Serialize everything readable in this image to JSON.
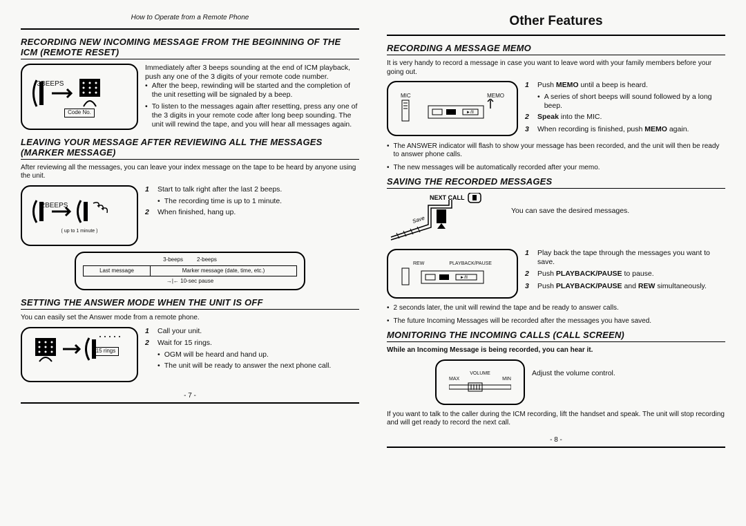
{
  "header": "How to Operate from a Remote Phone",
  "other_features": "Other Features",
  "page_left": "- 7 -",
  "page_right": "- 8 -",
  "left": {
    "sec1": {
      "title": "RECORDING NEW INCOMING MESSAGE FROM THE BEGINNING OF THE ICM (REMOTE RESET)",
      "fig_label": "3BEEPS",
      "fig_code": "Code No.",
      "body1": "Immediately after 3 beeps sounding at the end of ICM playback, push any one of the 3 digits of your remote code number.",
      "b1": "After the beep, rewinding will be started and the completion of the unit resetting will be signaled by a beep.",
      "b2": "To listen to the messages again after resetting, press any one of the 3 digits in your remote code after long beep sounding. The unit will rewind the tape, and you will hear all messages again."
    },
    "sec2": {
      "title": "LEAVING YOUR MESSAGE AFTER REVIEWING ALL THE MESSAGES (MARKER MESSAGE)",
      "intro": "After reviewing all the messages, you can leave your index message on the tape to be heard by anyone using the unit.",
      "fig_label": "2BEEPS",
      "fig_sub": "up to 1 minute",
      "s1": "Start to talk right after the last 2 beeps.",
      "s1b": "The recording time is up to 1 minute.",
      "s2": "When finished, hang up.",
      "tape_a": "3-beeps",
      "tape_b": "2-beeps",
      "tape_last": "Last message",
      "tape_marker": "Marker message (date, time, etc.)",
      "tape_pause": "10-sec pause"
    },
    "sec3": {
      "title": "SETTING THE ANSWER MODE WHEN THE UNIT IS OFF",
      "intro": "You can easily set the Answer mode from a remote phone.",
      "fig_rings": "15 rings",
      "s1": "Call your unit.",
      "s2": "Wait for 15 rings.",
      "s2a": "OGM will be heard and hand up.",
      "s2b": "The unit will be ready to answer the next phone call."
    }
  },
  "right": {
    "sec1": {
      "title": "RECORDING A MESSAGE MEMO",
      "intro": "It is very handy to record a message in case you want to leave word with your family members before your going out.",
      "fig_mic": "MIC",
      "fig_memo": "MEMO",
      "s1a": "Push ",
      "s1b": "MEMO",
      "s1c": " until a beep is heard.",
      "s1bul": "A series of short beeps will sound followed by a long beep.",
      "s2a": "Speak",
      "s2b": " into the MIC.",
      "s3a": "When recording is finished, push ",
      "s3b": "MEMO",
      "s3c": " again.",
      "n1": "The ANSWER indicator will flash to show your message has been recorded, and the unit will then be ready to answer phone calls.",
      "n2": "The new messages will be automatically recorded after your memo."
    },
    "sec2": {
      "title": "SAVING THE RECORDED MESSAGES",
      "fig_next": "NEXT CALL",
      "fig_save": "Save",
      "body1": "You can save the desired messages.",
      "fig_rew": "REW",
      "fig_pp": "PLAYBACK/PAUSE",
      "s1": "Play back the tape through the messages you want to save.",
      "s2a": "Push ",
      "s2b": "PLAYBACK/PAUSE",
      "s2c": " to pause.",
      "s3a": "Push ",
      "s3b": "PLAYBACK/PAUSE",
      "s3c": " and ",
      "s3d": "REW",
      "s3e": " simultaneously.",
      "n1": "2 seconds later, the unit will rewind the tape and be ready to answer calls.",
      "n2": "The future Incoming Messages will be recorded after the messages you have saved."
    },
    "sec3": {
      "title": "MONITORING THE INCOMING CALLS (CALL SCREEN)",
      "intro": "While an Incoming Message is being recorded, you can hear it.",
      "fig_vol": "VOLUME",
      "fig_max": "MAX",
      "fig_min": "MIN",
      "body": "Adjust the volume control.",
      "note": "If you want to talk to the caller during the ICM recording, lift the handset and speak. The unit will stop recording and will get ready to record the next call."
    }
  }
}
